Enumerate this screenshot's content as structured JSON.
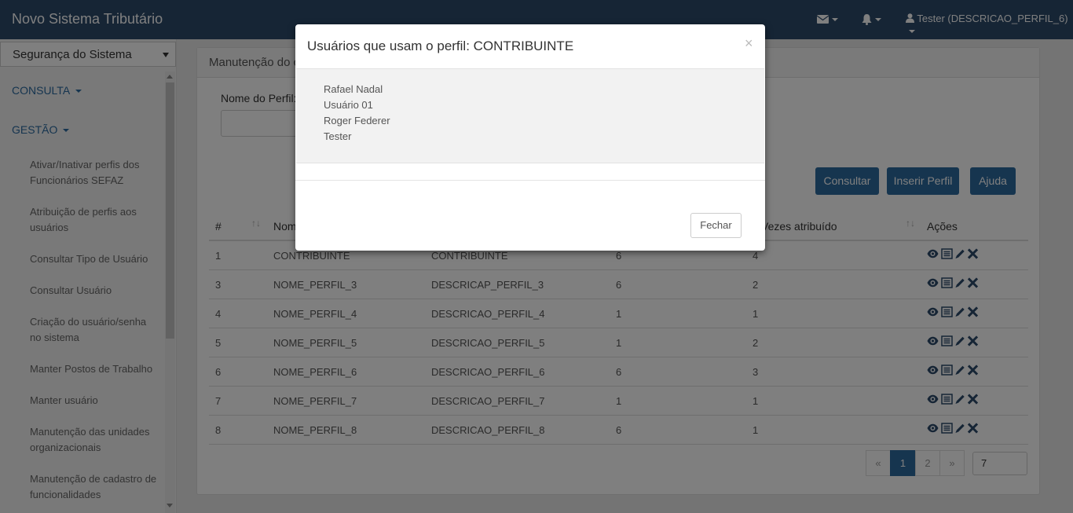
{
  "app": {
    "title": "Novo Sistema Tributário",
    "user_label": "Tester (DESCRICAO_PERFIL_6)"
  },
  "sidebar": {
    "module_selected": "Segurança do Sistema",
    "groups": [
      "CONSULTA",
      "GESTÃO"
    ],
    "items": [
      "Ativar/Inativar perfis dos Funcionários SEFAZ",
      "Atribuição de perfis aos usuários",
      "Consultar Tipo de Usuário",
      "Consultar Usuário",
      "Criação do usuário/senha no sistema",
      "Manter Postos de Trabalho",
      "Manter usuário",
      "Manutenção das unidades organizacionais",
      "Manutenção de cadastro de funcionalidades"
    ]
  },
  "panel": {
    "heading": "Manutenção do c",
    "field_label": "Nome do Perfil:",
    "buttons": {
      "consultar": "Consultar",
      "inserir": "Inserir Perfil",
      "ajuda": "Ajuda"
    }
  },
  "table": {
    "headers": {
      "num": "#",
      "nome": "Nom",
      "vezes": "Vezes atribuído",
      "acoes": "Ações"
    },
    "rows": [
      [
        "1",
        "CONTRIBUINTE",
        "CONTRIBUINTE",
        "6",
        "4"
      ],
      [
        "3",
        "NOME_PERFIL_3",
        "DESCRICAP_PERFIL_3",
        "6",
        "2"
      ],
      [
        "4",
        "NOME_PERFIL_4",
        "DESCRICAO_PERFIL_4",
        "1",
        "1"
      ],
      [
        "5",
        "NOME_PERFIL_5",
        "DESCRICAO_PERFIL_5",
        "1",
        "2"
      ],
      [
        "6",
        "NOME_PERFIL_6",
        "DESCRICAO_PERFIL_6",
        "6",
        "3"
      ],
      [
        "7",
        "NOME_PERFIL_7",
        "DESCRICAO_PERFIL_7",
        "1",
        "1"
      ],
      [
        "8",
        "NOME_PERFIL_8",
        "DESCRICAO_PERFIL_8",
        "6",
        "1"
      ]
    ],
    "action_icons": [
      "eye-icon",
      "list-icon",
      "pencil-icon",
      "delete-icon"
    ]
  },
  "pagination": {
    "prev": "«",
    "pages": [
      "1",
      "2"
    ],
    "current": "1",
    "next": "»",
    "page_size": "7"
  },
  "modal": {
    "title": "Usuários que usam o perfil: CONTRIBUINTE",
    "close_glyph": "×",
    "users": [
      "Rafael Nadal",
      "Usuário 01",
      "Roger Federer",
      "Tester"
    ],
    "close_button": "Fechar"
  },
  "colors": {
    "topbar": "#2c4a6b",
    "primary_button": "#2d6b9f",
    "menu_group": "#2c6ba0"
  }
}
